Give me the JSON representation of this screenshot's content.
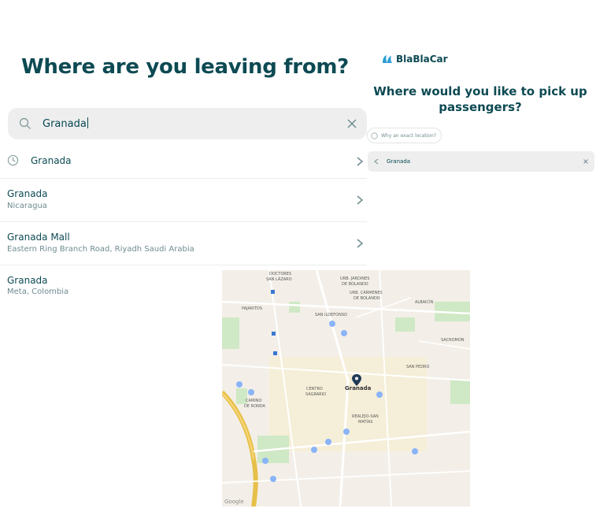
{
  "left_screen": {
    "title": "Where are you leaving from?",
    "search": {
      "value": "Granada"
    },
    "results": [
      {
        "title": "Granada",
        "subtitle": "",
        "icon": "clock-icon"
      },
      {
        "title": "Granada",
        "subtitle": "Nicaragua"
      },
      {
        "title": "Granada Mall",
        "subtitle": "Eastern Ring Branch Road, Riyadh Saudi Arabia"
      },
      {
        "title": "Granada",
        "subtitle": "Meta, Colombia"
      }
    ]
  },
  "right_screen": {
    "brand": "BlaBlaCar",
    "title": "Where would you like to pick up passengers?",
    "why_exact": "Why an exact location?",
    "search_value": "Granada"
  },
  "map": {
    "labels": {
      "doctores": "DOCTORES",
      "san_lazaro": "SAN LÁZARO",
      "jardines": "URB. JARDINES",
      "de_bolando": "DE BOLANDO",
      "carmenes": "URB. CÁRMENES",
      "de_bolando2": "DE BOLANDO",
      "albaicin": "ALBAICÍN",
      "pajaritos": "PAJARITOS",
      "san_ildefonso": "SAN ILDEFONSO",
      "sacromonte": "SACROMON",
      "san_pedro": "SAN PEDRO",
      "centro": "CENTRO",
      "sagrario": "SAGRARIO",
      "granada": "Granada",
      "camino": "CAMINO",
      "de_ronda": "DE RONDA",
      "realejo": "REALEJO-SAN",
      "matias": "MATÍAS",
      "google": "Google"
    },
    "colors": {
      "water": "#e7c04a",
      "park": "#cfe8c5",
      "road": "#ffffff",
      "pin": "#1a73e8"
    }
  }
}
